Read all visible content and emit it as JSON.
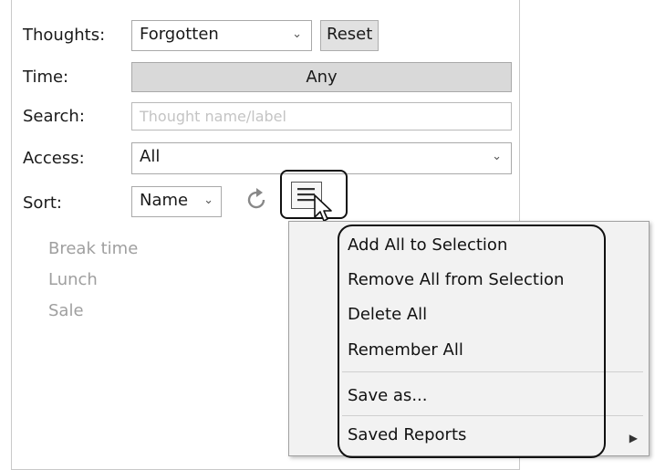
{
  "filters": {
    "thoughts_label": "Thoughts:",
    "thoughts_value": "Forgotten",
    "reset_label": "Reset",
    "time_label": "Time:",
    "time_value": "Any",
    "search_label": "Search:",
    "search_placeholder": "Thought name/label",
    "access_label": "Access:",
    "access_value": "All",
    "sort_label": "Sort:",
    "sort_value": "Name"
  },
  "results": [
    {
      "label": "Break time"
    },
    {
      "label": "Lunch"
    },
    {
      "label": "Sale"
    }
  ],
  "menu": {
    "items": [
      {
        "label": "Add All to Selection"
      },
      {
        "label": "Remove All from Selection"
      },
      {
        "label": "Delete All"
      },
      {
        "label": "Remember All"
      },
      {
        "label": "Save as..."
      },
      {
        "label": "Saved Reports"
      }
    ]
  }
}
